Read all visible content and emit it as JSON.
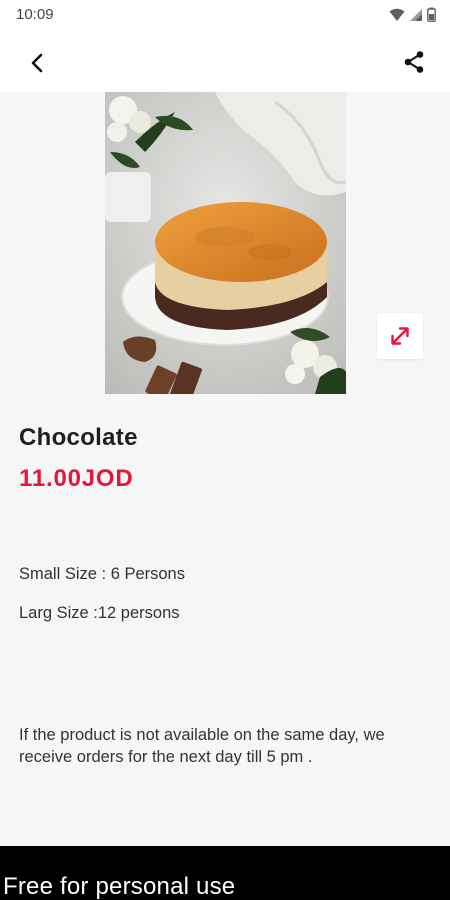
{
  "status_bar": {
    "time": "10:09",
    "icons": [
      "wifi-icon",
      "signal-icon",
      "battery-icon"
    ]
  },
  "app_bar": {
    "back_icon": "back-arrow-icon",
    "share_icon": "share-icon"
  },
  "product": {
    "image_alt": "Chocolate cheesecake",
    "name": "Chocolate",
    "price": "11.00JOD",
    "expand_icon": "expand-icon",
    "sizes": {
      "small": "Small Size : 6 Persons",
      "large": "Larg Size :12 persons"
    },
    "notice": "If the product is not available on the same day, we receive orders for the next day till 5 pm ."
  },
  "footer": {
    "text": "Free for personal use"
  },
  "colors": {
    "price": "#e3173a",
    "accent_icon": "#e3173a",
    "background": "#f6f6f6",
    "app_bar": "#ffffff",
    "footer": "#000000"
  }
}
